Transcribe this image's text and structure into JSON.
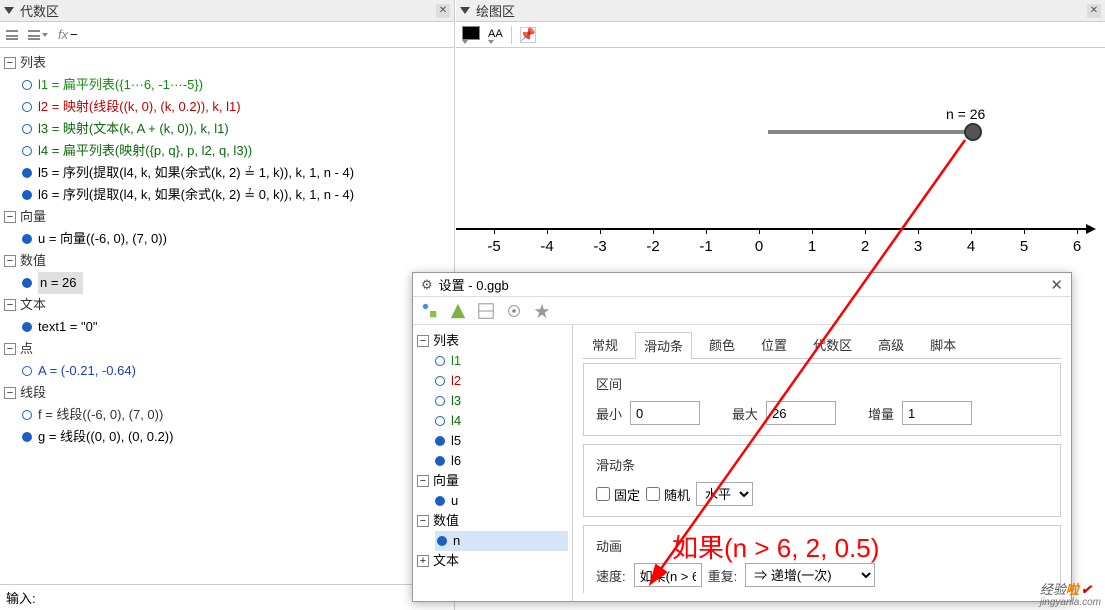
{
  "algebra": {
    "title": "代数区",
    "cats": {
      "list": "列表",
      "vector": "向量",
      "number": "数值",
      "text": "文本",
      "point": "点",
      "segment": "线段"
    },
    "items": {
      "l1": "l1 = 扁平列表({1···6, -1···-5})",
      "l2": "l2 = 映射(线段((k, 0), (k, 0.2)), k, l1)",
      "l3": "l3 = 映射(文本(k, A + (k, 0)), k, l1)",
      "l4": "l4 = 扁平列表(映射({p, q}, p, l2, q, l3))",
      "l5": "l5 = 序列(提取(l4, k, 如果(余式(k, 2) ≟ 1, k)), k, 1, n - 4)",
      "l6": "l6 = 序列(提取(l4, k, 如果(余式(k, 2) ≟ 0, k)), k, 1, n - 4)",
      "u": "u = 向量((-6, 0), (7, 0))",
      "n": "n = 26",
      "text1": "text1 = \"0\"",
      "A": "A = (-0.21, -0.64)",
      "f": "f = 线段((-6, 0), (7, 0))",
      "g": "g = 线段((0, 0), (0, 0.2))"
    },
    "input_label": "输入:"
  },
  "graphics": {
    "title": "绘图区",
    "slider_label": "n = 26",
    "ticks": [
      "-5",
      "-4",
      "-3",
      "-2",
      "-1",
      "0",
      "1",
      "2",
      "3",
      "4",
      "5",
      "6"
    ],
    "font_label": "AA"
  },
  "dialog": {
    "title": "设置 - 0.ggb",
    "tree": {
      "list": "列表",
      "l1": "l1",
      "l2": "l2",
      "l3": "l3",
      "l4": "l4",
      "l5": "l5",
      "l6": "l6",
      "vector": "向量",
      "u": "u",
      "number": "数值",
      "n": "n",
      "text": "文本"
    },
    "tabs": {
      "general": "常规",
      "slider": "滑动条",
      "color": "颜色",
      "position": "位置",
      "algebra": "代数区",
      "advanced": "高级",
      "script": "脚本"
    },
    "interval": {
      "title": "区间",
      "min_lbl": "最小",
      "min": "0",
      "max_lbl": "最大",
      "max": "26",
      "incr_lbl": "增量",
      "incr": "1"
    },
    "sliderbar": {
      "title": "滑动条",
      "fixed": "固定",
      "random": "随机",
      "orient": "水平"
    },
    "anim": {
      "title": "动画",
      "speed_lbl": "速度:",
      "speed": "如果(n > 6",
      "repeat_lbl": "重复:",
      "repeat": "⇒ 递增(一次)"
    }
  },
  "annotation": "如果(n > 6, 2, 0.5)",
  "watermark": {
    "a": "经验",
    "b": "啦",
    "c": "✔",
    "d": "jingyanla.com"
  },
  "glyph": {
    "fx": "fx",
    "minus": "−",
    "AA": "AA",
    "pin": "📌"
  }
}
